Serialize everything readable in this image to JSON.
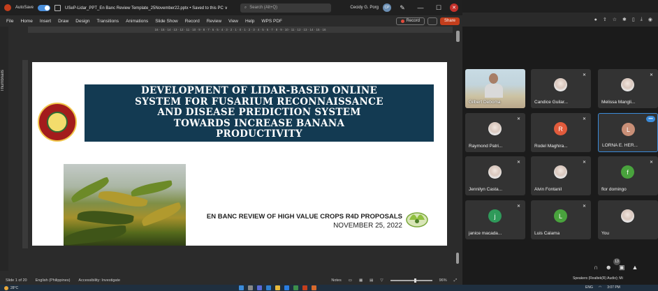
{
  "titlebar": {
    "autosave_label": "AutoSave",
    "doc_title": "USeP-Lidar_PPT_En Banc Review Template_25November22.pptx • Saved to this PC ∨",
    "search_placeholder": "Search (Alt+Q)",
    "user_name": "Cecidy G. Porg",
    "user_initials": "CP",
    "minimize_glyph": "—",
    "maximize_glyph": "☐",
    "close_glyph": "✕"
  },
  "menubar": {
    "items": [
      "File",
      "Home",
      "Insert",
      "Draw",
      "Design",
      "Transitions",
      "Animations",
      "Slide Show",
      "Record",
      "Review",
      "View",
      "Help",
      "WPS PDF"
    ],
    "record_label": "Record",
    "share_label": "Share"
  },
  "ruler": {
    "ticks": "16 · 15 · 14 · 13 · 12 · 11 · 10 · 9 · 8 · 7 · 6 · 5 · 4 · 3 · 2 · 1 · 0 · 1 · 2 · 3 · 4 · 5 · 6 · 7 · 8 · 9 · 10 · 11 · 12 · 13 · 14 · 15 · 16"
  },
  "sidebar": {
    "thumbnails_label": "Thumbnails"
  },
  "slide": {
    "title_lines": [
      "DEVELOPMENT OF LIDAR-BASED ONLINE",
      "SYSTEM FOR FUSARIUM RECONNAISSANCE",
      "AND DISEASE PREDICTION SYSTEM",
      "TOWARDS INCREASE BANANA",
      "PRODUCTIVITY"
    ],
    "review_title": "EN BANC REVIEW OF HIGH VALUE CROPS R4D PROPOSALS",
    "review_date": "NOVEMBER 25, 2022"
  },
  "statusbar": {
    "slide_count": "Slide 1 of 20",
    "language": "English (Philippines)",
    "accessibility": "Accessibility: Investigate",
    "notes": "Notes",
    "zoom": "96%"
  },
  "taskbar": {
    "weather": "28°C",
    "lang": "ENG",
    "time": "3:07 PM"
  },
  "participants": [
    {
      "name": "Gilbert Deboma",
      "type": "video"
    },
    {
      "name": "Candice Guilar...",
      "type": "photo"
    },
    {
      "name": "Melissa Mangli...",
      "type": "photo"
    },
    {
      "name": "Raymond Patri...",
      "type": "photo"
    },
    {
      "name": "Rodel Maghira...",
      "type": "initial",
      "initial": "R",
      "color": "#e25b3c"
    },
    {
      "name": "LORNA E. HER...",
      "type": "initial",
      "initial": "L",
      "color": "#c98f77"
    },
    {
      "name": "Jennilyn Casta...",
      "type": "photo"
    },
    {
      "name": "Alvin Fontanil",
      "type": "photo"
    },
    {
      "name": "flor domingo",
      "type": "initial",
      "initial": "f",
      "color": "#49a33d"
    },
    {
      "name": "janice macada...",
      "type": "initial",
      "initial": "j",
      "color": "#2f9a5a"
    },
    {
      "name": "Luis Calama",
      "type": "initial",
      "initial": "L",
      "color": "#49a33d"
    },
    {
      "name": "You",
      "type": "photo"
    }
  ],
  "zoom_meeting": {
    "participant_count": "13",
    "audio_label": "Speakers (Realtek(R) Audio); Mi"
  },
  "colors": {
    "title_box": "#133a52",
    "share": "#c43e1c",
    "active_border": "#3b8bd9"
  }
}
